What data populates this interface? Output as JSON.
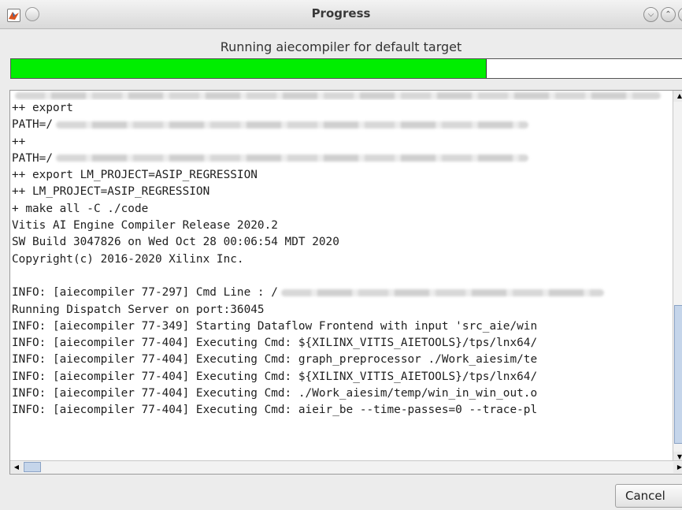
{
  "window": {
    "title": "Progress",
    "app_icon": "matlab-icon"
  },
  "status": {
    "message": "Running aiecompiler for default target"
  },
  "progress": {
    "fraction": 0.705,
    "fill_color": "#00ee00"
  },
  "log": {
    "lines": [
      "++ export",
      "PATH=/",
      "++",
      "PATH=/",
      "++ export LM_PROJECT=ASIP_REGRESSION",
      "++ LM_PROJECT=ASIP_REGRESSION",
      "+ make all -C ./code",
      "Vitis AI Engine Compiler Release 2020.2",
      "SW Build 3047826 on Wed Oct 28 00:06:54 MDT 2020",
      "Copyright(c) 2016-2020 Xilinx Inc.",
      "",
      "INFO: [aiecompiler 77-297] Cmd Line : /",
      "Running Dispatch Server on port:36045",
      "INFO: [aiecompiler 77-349] Starting Dataflow Frontend with input 'src_aie/win",
      "INFO: [aiecompiler 77-404] Executing Cmd: ${XILINX_VITIS_AIETOOLS}/tps/lnx64/",
      "INFO: [aiecompiler 77-404] Executing Cmd: graph_preprocessor ./Work_aiesim/te",
      "INFO: [aiecompiler 77-404] Executing Cmd: ${XILINX_VITIS_AIETOOLS}/tps/lnx64/",
      "INFO: [aiecompiler 77-404] Executing Cmd: ./Work_aiesim/temp/win_in_win_out.o",
      "INFO: [aiecompiler 77-404] Executing Cmd: aieir_be --time-passes=0 --trace-pl"
    ]
  },
  "buttons": {
    "cancel": "Cancel"
  }
}
